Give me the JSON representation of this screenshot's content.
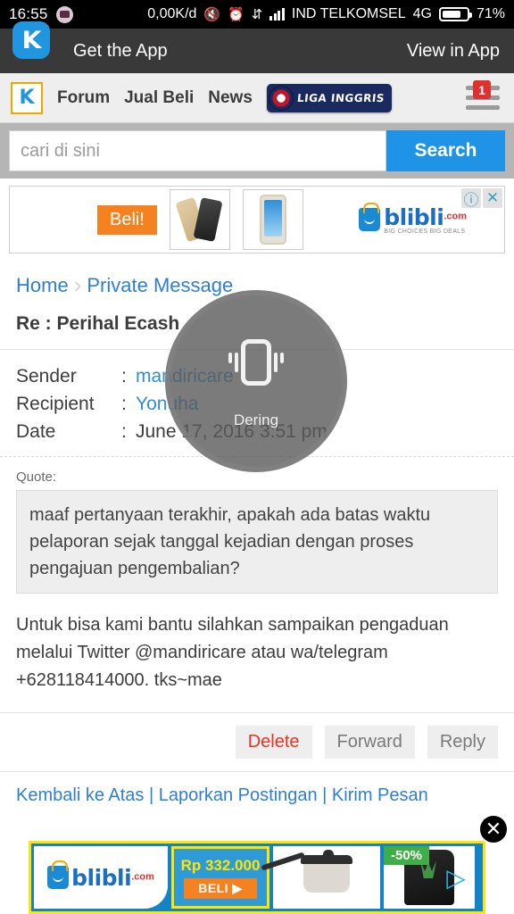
{
  "status_bar": {
    "time": "16:55",
    "data_rate": "0,00K/d",
    "carrier": "IND TELKOMSEL",
    "network": "4G",
    "battery": "71%",
    "icons": [
      "bbm-icon",
      "mute-icon",
      "alarm-icon",
      "data-transfer-icon",
      "signal-icon",
      "battery-icon"
    ]
  },
  "app_banner": {
    "logo_letter": "K",
    "title": "Get the App",
    "action": "View in App"
  },
  "nav": {
    "logo_letter": "K",
    "links": [
      "Forum",
      "Jual Beli",
      "News"
    ],
    "badge_label": "LIGA INGGRIS",
    "menu_badge": "1"
  },
  "search": {
    "placeholder": "cari di sini",
    "value": "",
    "button": "Search"
  },
  "top_ad": {
    "cta": "Beli!",
    "brand": "blibli",
    "brand_suffix": ".com",
    "tagline": "BIG CHOICES  BIG DEALS",
    "info_icon": "ⓘ",
    "close_icon": "✕"
  },
  "breadcrumb": {
    "home": "Home",
    "separator": "›",
    "current": "Private Message"
  },
  "message": {
    "title": "Re : Perihal Ecash",
    "sender_label": "Sender",
    "sender": "mandiricare",
    "recipient_label": "Recipient",
    "recipient": "Yonuha",
    "date_label": "Date",
    "date": "June 17, 2016 3:51 pm",
    "colon": ":",
    "quote_label": "Quote:",
    "quote_text": "maaf pertanyaan terakhir, apakah ada batas waktu pelaporan sejak tanggal kejadian dengan proses pengajuan pengembalian?",
    "body": "Untuk bisa kami bantu silahkan sampaikan pengaduan melalui Twitter @mandiricare atau wa/telegram +628118414000. tks~mae",
    "actions": {
      "delete": "Delete",
      "forward": "Forward",
      "reply": "Reply"
    },
    "tail_text": "Kembali ke Atas | Laporkan Postingan | Kirim Pesan"
  },
  "overlay": {
    "icon": "vibrate-icon",
    "label": "Dering"
  },
  "bottom_ad": {
    "brand": "blibli",
    "brand_suffix": ".com",
    "price": "Rp 332.000",
    "cta": "BELI ▶",
    "discount": "-50%",
    "close_icon": "✕",
    "arrow_icon": "▷"
  },
  "colors": {
    "accent_blue": "#1f93e5",
    "link_blue": "#2f7fd1",
    "orange": "#f58220",
    "danger_red": "#ea3323",
    "badge_red": "#e03131",
    "yellow": "#ffe600",
    "green": "#3fae49"
  }
}
